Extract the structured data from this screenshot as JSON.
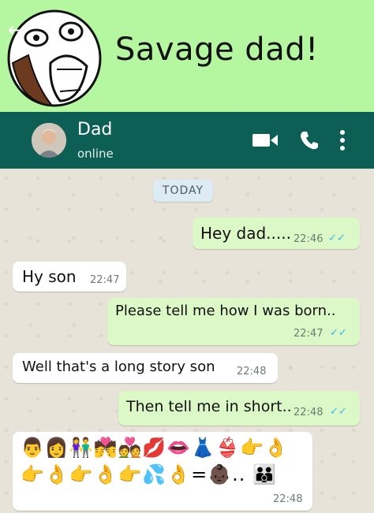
{
  "meme": {
    "title": "Savage dad!",
    "face_icon": "rage-face-icon"
  },
  "header": {
    "back_icon": "←",
    "contact_name": "Dad",
    "status": "online",
    "icons": [
      "video-call-icon",
      "phone-icon",
      "more-vert-icon"
    ],
    "bar_color": "#0d5e54"
  },
  "chat": {
    "date_chip": "TODAY",
    "messages": [
      {
        "direction": "out",
        "text": "Hey dad.....",
        "time": "22:46",
        "ticks": "✓✓"
      },
      {
        "direction": "in",
        "text": "Hy son",
        "time": "22:47"
      },
      {
        "direction": "out",
        "text": "Please tell me how I was born..",
        "time": "22:47",
        "ticks": "✓✓"
      },
      {
        "direction": "in",
        "text": "Well that's a long story son",
        "time": "22:48"
      },
      {
        "direction": "out",
        "text": "Then tell me in short..",
        "time": "22:48",
        "ticks": "✓✓"
      },
      {
        "direction": "in",
        "emoji_line1": "👨👩👫💏💑💋👄👗👙👉👌",
        "emoji_line2": "👉👌👉👌👉💦👌=",
        "emoji_line2_end": "👶🏿.. 👪",
        "time": "22:48"
      }
    ],
    "colors": {
      "outgoing": "#dcf8c6",
      "incoming": "#ffffff",
      "tick": "#34b7f1"
    }
  }
}
